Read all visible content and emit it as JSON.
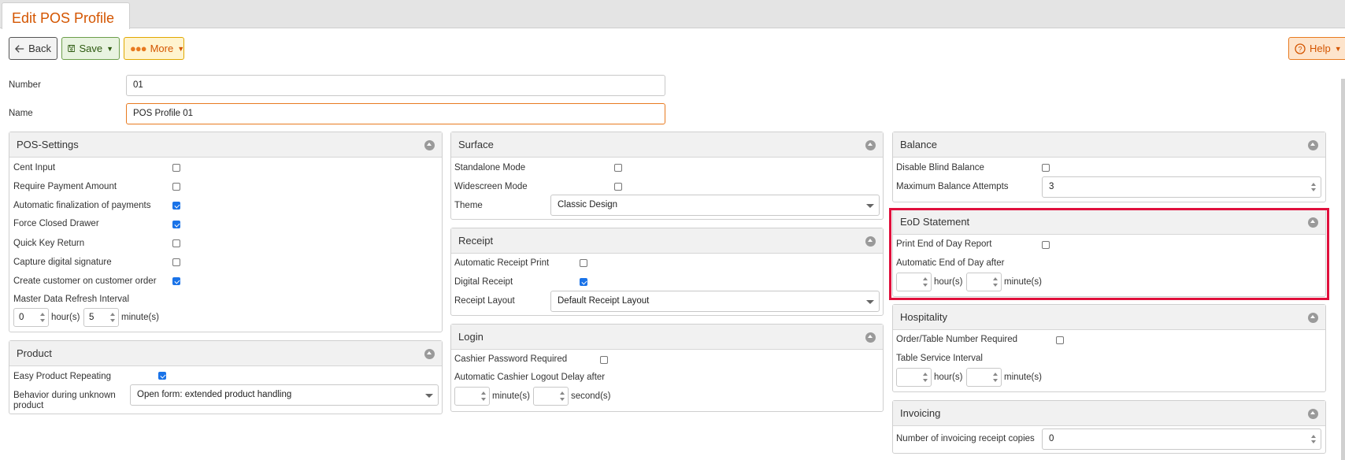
{
  "tab": {
    "title": "Edit POS Profile"
  },
  "toolbar": {
    "back": "Back",
    "save": "Save",
    "more": "More",
    "help": "Help"
  },
  "form": {
    "number_label": "Number",
    "number_value": "01",
    "name_label": "Name",
    "name_value": "POS Profile 01"
  },
  "pos_settings": {
    "title": "POS-Settings",
    "cent_input": "Cent Input",
    "require_payment": "Require Payment Amount",
    "auto_finalization": "Automatic finalization of payments",
    "force_closed": "Force Closed Drawer",
    "quick_key": "Quick Key Return",
    "capture_signature": "Capture digital signature",
    "create_customer": "Create customer on customer order",
    "refresh_interval": "Master Data Refresh Interval",
    "hours_value": "0",
    "hours_unit": "hour(s)",
    "minutes_value": "5",
    "minutes_unit": "minute(s)"
  },
  "product": {
    "title": "Product",
    "easy_repeating": "Easy Product Repeating",
    "behavior_label_1": "Behavior during unknown",
    "behavior_label_2": "product",
    "behavior_value": "Open form: extended product handling"
  },
  "surface": {
    "title": "Surface",
    "standalone": "Standalone Mode",
    "widescreen": "Widescreen Mode",
    "theme_label": "Theme",
    "theme_value": "Classic Design"
  },
  "receipt": {
    "title": "Receipt",
    "auto_print": "Automatic Receipt Print",
    "digital": "Digital Receipt",
    "layout_label": "Receipt Layout",
    "layout_value": "Default Receipt Layout"
  },
  "login": {
    "title": "Login",
    "password_required": "Cashier Password Required",
    "logout_delay": "Automatic Cashier Logout Delay after",
    "minutes_unit": "minute(s)",
    "seconds_unit": "second(s)"
  },
  "balance": {
    "title": "Balance",
    "disable_blind": "Disable Blind Balance",
    "max_attempts_label": "Maximum Balance Attempts",
    "max_attempts_value": "3"
  },
  "eod": {
    "title": "EoD Statement",
    "print_report": "Print End of Day Report",
    "auto_after": "Automatic End of Day after",
    "hours_unit": "hour(s)",
    "minutes_unit": "minute(s)"
  },
  "hospitality": {
    "title": "Hospitality",
    "order_table": "Order/Table Number Required",
    "service_interval": "Table Service Interval",
    "hours_unit": "hour(s)",
    "minutes_unit": "minute(s)"
  },
  "invoicing": {
    "title": "Invoicing",
    "copies_label": "Number of invoicing receipt copies",
    "copies_value": "0"
  },
  "checkboxes": {
    "cent_input": false,
    "require_payment": false,
    "auto_finalization": true,
    "force_closed": true,
    "quick_key": false,
    "capture_signature": false,
    "create_customer": true,
    "easy_repeating": true,
    "standalone": false,
    "widescreen": false,
    "auto_print": false,
    "digital": true,
    "password_required": false,
    "disable_blind": false,
    "print_report": false,
    "order_table": false
  },
  "colors": {
    "accent": "#d45500",
    "highlight": "#e0103c",
    "checked": "#1a73e8"
  }
}
